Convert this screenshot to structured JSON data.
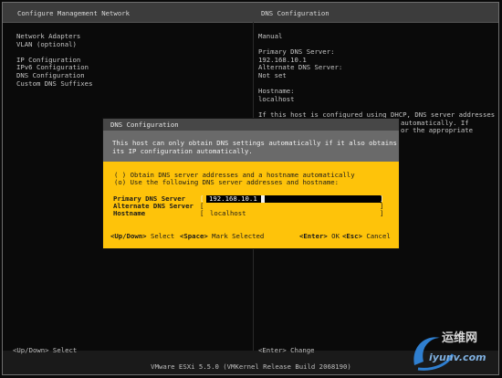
{
  "header": {
    "left_title": "Configure Management Network",
    "right_title": "DNS Configuration"
  },
  "menu": {
    "items": [
      "Network Adapters",
      "VLAN (optional)",
      "IP Configuration",
      "IPv6 Configuration",
      "DNS Configuration",
      "Custom DNS Suffixes"
    ]
  },
  "right_panel": {
    "mode": "Manual",
    "primary_label": "Primary DNS Server:",
    "primary_value": "192.168.10.1",
    "alternate_label": "Alternate DNS Server:",
    "alternate_value": "Not set",
    "hostname_label": "Hostname:",
    "hostname_value": "localhost",
    "note_line1": "If this host is configured using DHCP, DNS server addresses",
    "note_line2": "automatically. If",
    "note_line3": "or the appropriate"
  },
  "dialog": {
    "title": "DNS Configuration",
    "message_line1": "This host can only obtain DNS settings automatically if it also obtains",
    "message_line2": "its IP configuration automatically.",
    "option_auto": "( ) Obtain DNS server addresses and a hostname automatically",
    "option_manual": "(o) Use the following DNS server addresses and hostname:",
    "fields": {
      "primary_label": "Primary DNS Server",
      "primary_value": "192.168.10.1",
      "alternate_label": "Alternate DNS Server",
      "alternate_value": "",
      "hostname_label": "Hostname",
      "hostname_value": "localhost"
    },
    "footer": {
      "updown_key": "<Up/Down>",
      "updown_action": "Select",
      "space_key": "<Space>",
      "space_action": "Mark Selected",
      "enter_key": "<Enter>",
      "enter_action": "OK",
      "esc_key": "<Esc>",
      "esc_action": "Cancel"
    }
  },
  "footer": {
    "left_hint": "<Up/Down> Select",
    "right_hint": "<Enter> Change"
  },
  "status_bar": "VMware ESXi 5.5.0 (VMKernel Release Build 2068190)",
  "watermark": {
    "line1": "运维网",
    "line2": "iyunv.com"
  },
  "colors": {
    "dialog_bg": "#fec30a",
    "title_bg": "#474747",
    "message_bg": "#6a6a6a"
  }
}
